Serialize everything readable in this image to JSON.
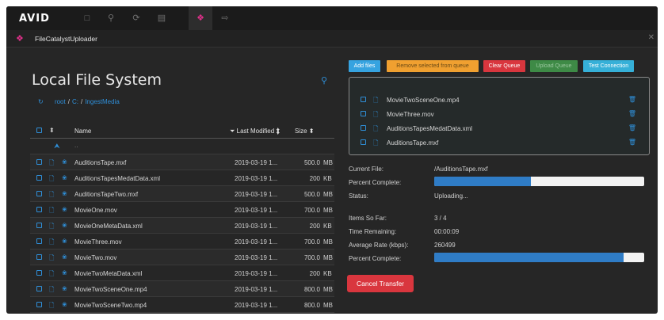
{
  "app": {
    "logo": "AVID",
    "window_title": "FileCatalystUploader"
  },
  "topbar": {
    "icons": [
      "folder-icon",
      "search-icon",
      "history-icon",
      "library-icon",
      "filecatalyst-icon",
      "export-icon"
    ]
  },
  "local": {
    "title": "Local File System",
    "breadcrumb": [
      "root",
      "C:",
      "IngestMedia"
    ],
    "columns": {
      "name": "Name",
      "last_modified": "Last Modified",
      "size": "Size"
    },
    "parent": "..",
    "files": [
      {
        "name": "AuditionsTape.mxf",
        "modified": "2019-03-19 1...",
        "size": "500.0",
        "unit": "MB"
      },
      {
        "name": "AuditionsTapesMedatData.xml",
        "modified": "2019-03-19 1...",
        "size": "200",
        "unit": "KB"
      },
      {
        "name": "AuditionsTapeTwo.mxf",
        "modified": "2019-03-19 1...",
        "size": "500.0",
        "unit": "MB"
      },
      {
        "name": "MovieOne.mov",
        "modified": "2019-03-19 1...",
        "size": "700.0",
        "unit": "MB"
      },
      {
        "name": "MovieOneMetaData.xml",
        "modified": "2019-03-19 1...",
        "size": "200",
        "unit": "KB"
      },
      {
        "name": "MovieThree.mov",
        "modified": "2019-03-19 1...",
        "size": "700.0",
        "unit": "MB"
      },
      {
        "name": "MovieTwo.mov",
        "modified": "2019-03-19 1...",
        "size": "700.0",
        "unit": "MB"
      },
      {
        "name": "MovieTwoMetaData.xml",
        "modified": "2019-03-19 1...",
        "size": "200",
        "unit": "KB"
      },
      {
        "name": "MovieTwoSceneOne.mp4",
        "modified": "2019-03-19 1...",
        "size": "800.0",
        "unit": "MB"
      },
      {
        "name": "MovieTwoSceneTwo.mp4",
        "modified": "2019-03-19 1...",
        "size": "800.0",
        "unit": "MB"
      }
    ]
  },
  "toolbar": {
    "add_files": "Add files",
    "remove_selected": "Remove selected from queue",
    "clear_queue": "Clear Queue",
    "upload_queue": "Upload Queue",
    "test_connection": "Test Connection"
  },
  "queue": [
    "MovieTwoSceneOne.mp4",
    "MovieThree.mov",
    "AuditionsTapesMedatData.xml",
    "AuditionsTape.mxf"
  ],
  "status": {
    "current_file_label": "Current File:",
    "current_file": "/AuditionsTape.mxf",
    "percent_label": "Percent Complete:",
    "file_percent": 0.46,
    "status_label": "Status:",
    "status": "Uploading...",
    "items_label": "Items So Far:",
    "items": "3 / 4",
    "remaining_label": "Time Remaining:",
    "remaining": "00:00:09",
    "rate_label": "Average Rate (kbps):",
    "rate": "260499",
    "total_percent_label": "Percent Complete:",
    "total_percent": 0.9
  },
  "cancel_label": "Cancel Transfer",
  "colors": {
    "accent": "#2f8fd8",
    "brand": "#e0308a",
    "danger": "#d9363e"
  }
}
